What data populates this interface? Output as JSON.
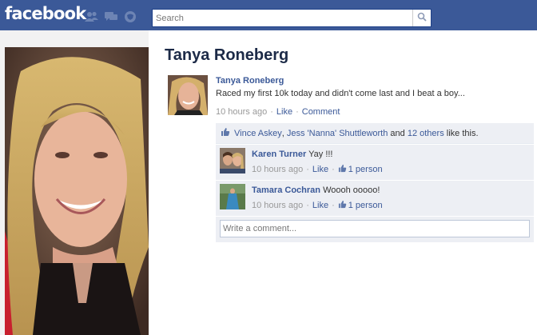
{
  "header": {
    "logo": "facebook",
    "icons": [
      "friend-requests-icon",
      "messages-icon",
      "notifications-icon"
    ],
    "search": {
      "placeholder": "Search",
      "value": ""
    }
  },
  "profile": {
    "name": "Tanya Roneberg"
  },
  "story": {
    "author": "Tanya Roneberg",
    "message": "Raced my first 10k today and didn't come last and I beat a boy...",
    "time": "10 hours ago",
    "like_label": "Like",
    "comment_label": "Comment"
  },
  "likes": {
    "names": [
      "Vince Askey",
      "Jess 'Nanna' Shuttleworth"
    ],
    "separator": ",",
    "and_text": "and",
    "others_text": "12 others",
    "tail_text": "like this."
  },
  "comments": [
    {
      "author": "Karen Turner",
      "text": "Yay !!!",
      "time": "10 hours ago",
      "like_label": "Like",
      "likes": "1 person"
    },
    {
      "author": "Tamara Cochran",
      "text": "Woooh ooooo!",
      "time": "10 hours ago",
      "like_label": "Like",
      "likes": "1 person"
    }
  ],
  "composer": {
    "placeholder": "Write a comment..."
  },
  "colors": {
    "brand": "#3b5998",
    "ufi_bg": "#edeff4",
    "link": "#3b5998"
  }
}
